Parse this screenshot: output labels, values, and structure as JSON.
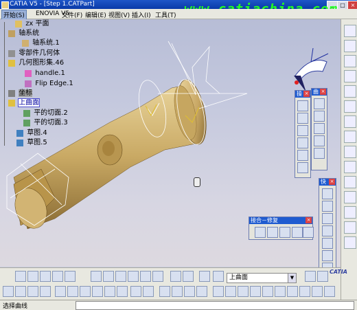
{
  "window": {
    "title": "CATIA V5 - [Step 1.CATPart]",
    "min": "_",
    "max": "□",
    "close": "×"
  },
  "watermark": "www.catiachina.com",
  "menubar": {
    "items": [
      "开始(S)",
      "ENOVIA V5",
      "文件(F)",
      "编辑(E)",
      "视图(V)",
      "插入(I)",
      "工具(T)"
    ]
  },
  "tree": {
    "nodes": [
      {
        "label": "zx 平面"
      },
      {
        "label": "轴系统"
      },
      {
        "label": "轴系统.1"
      },
      {
        "label": "零部件几何体"
      },
      {
        "label": "几何图形集.46"
      },
      {
        "label": "handle.1"
      },
      {
        "label": "Flip Edge.1"
      },
      {
        "label": "坐标"
      },
      {
        "label": "上曲面"
      },
      {
        "label": "平的切面.2"
      },
      {
        "label": "平的切面.3"
      },
      {
        "label": "草图.4"
      },
      {
        "label": "草图.5"
      }
    ]
  },
  "toolbars": {
    "surfaces": {
      "title": "曲",
      "close": "×"
    },
    "operations": {
      "title": "操",
      "close": "×"
    },
    "quick": {
      "title": "快",
      "close": "×"
    },
    "join_repair": {
      "title": "接合－修复",
      "close": "×"
    }
  },
  "layer_combo": {
    "value": "上曲面"
  },
  "status": {
    "text": "选择曲线"
  },
  "brand": "CATIA"
}
